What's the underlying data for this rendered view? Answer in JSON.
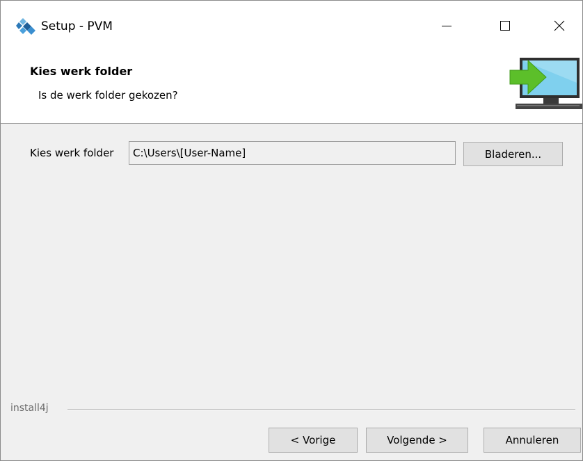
{
  "window": {
    "title": "Setup - PVM",
    "app_icon": "install4j-diamond-icon",
    "controls": {
      "minimize_icon": "minimize-icon",
      "maximize_icon": "maximize-icon",
      "close_icon": "close-icon"
    }
  },
  "header": {
    "title": "Kies werk folder",
    "subtitle": "Is de werk folder gekozen?",
    "icon": "monitor-arrow-icon"
  },
  "form": {
    "folder_label": "Kies werk folder",
    "folder_value": "C:\\Users\\[User-Name]",
    "browse_label": "Bladeren..."
  },
  "footer": {
    "branding": "install4j",
    "back_label": "< Vorige",
    "next_label": "Volgende >",
    "cancel_label": "Annuleren"
  },
  "colors": {
    "window_bg": "#f0f0f0",
    "header_bg": "#ffffff",
    "button_bg": "#e1e1e1",
    "button_border": "#adadad",
    "arrow_green": "#5cbf2a",
    "monitor_blue": "#6ec6e8"
  }
}
